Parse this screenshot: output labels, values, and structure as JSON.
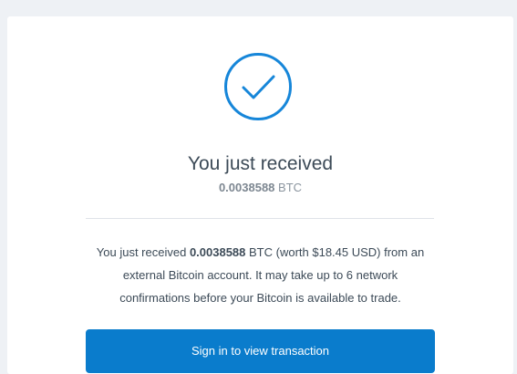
{
  "colors": {
    "accent": "#0a7ccc",
    "check_blue": "#1686d9",
    "text": "#3c4a57",
    "muted": "#8a949e",
    "page_bg": "#eef1f5"
  },
  "icon": "check-circle-icon",
  "headline": "You just received",
  "amount": {
    "value": "0.0038588",
    "unit": "BTC"
  },
  "message": {
    "prefix": "You just received",
    "amount": "0.0038588",
    "line1_rest": "BTC (worth $18.45 USD) from an",
    "line2": "external Bitcoin account. It may take up to 6 network",
    "line3": "confirmations before your Bitcoin is available to trade."
  },
  "cta_label": "Sign in to view transaction"
}
